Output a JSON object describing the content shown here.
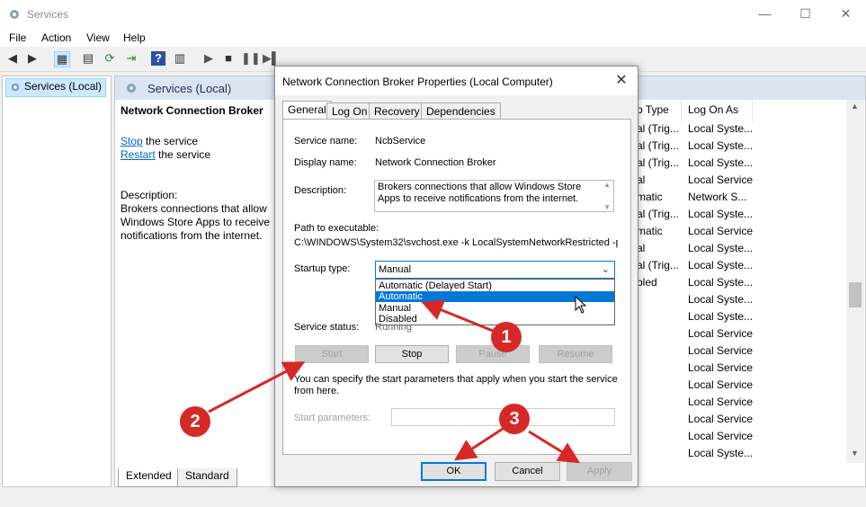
{
  "window": {
    "title": "Services",
    "minimize": "—",
    "maximize": "☐",
    "close": "✕"
  },
  "menu": [
    "File",
    "Action",
    "View",
    "Help"
  ],
  "tree": {
    "item": "Services (Local)"
  },
  "content": {
    "header": "Services (Local)",
    "service_name": "Network Connection Broker",
    "stop_link": "Stop",
    "stop_suffix": " the service",
    "restart_link": "Restart",
    "restart_suffix": " the service",
    "description_label": "Description:",
    "description_lines": [
      "Brokers connections that allow",
      "Windows Store Apps to receive",
      "notifications from the internet."
    ],
    "columns": {
      "startup": "p Type",
      "logon": "Log On As"
    },
    "rows": [
      {
        "s": "al (Trig...",
        "l": "Local Syste..."
      },
      {
        "s": "al (Trig...",
        "l": "Local Syste..."
      },
      {
        "s": "al (Trig...",
        "l": "Local Syste..."
      },
      {
        "s": "al",
        "l": "Local Service"
      },
      {
        "s": "matic",
        "l": "Network S..."
      },
      {
        "s": "al (Trig...",
        "l": "Local Syste..."
      },
      {
        "s": "matic",
        "l": "Local Service"
      },
      {
        "s": "al",
        "l": "Local Syste..."
      },
      {
        "s": "al (Trig...",
        "l": "Local Syste..."
      },
      {
        "s": "bled",
        "l": "Local Syste..."
      },
      {
        "s": "",
        "l": "Local Syste..."
      },
      {
        "s": "",
        "l": "Local Syste..."
      },
      {
        "s": "",
        "l": "Local Service"
      },
      {
        "s": "",
        "l": "Local Service"
      },
      {
        "s": "",
        "l": "Local Service"
      },
      {
        "s": "",
        "l": "Local Service"
      },
      {
        "s": "",
        "l": "Local Service"
      },
      {
        "s": "",
        "l": "Local Service"
      },
      {
        "s": "",
        "l": "Local Service"
      },
      {
        "s": "",
        "l": "Local Syste..."
      }
    ],
    "tabs": [
      "Extended",
      "Standard"
    ]
  },
  "dialog": {
    "title": "Network Connection Broker Properties (Local Computer)",
    "close": "✕",
    "tabs": [
      "General",
      "Log On",
      "Recovery",
      "Dependencies"
    ],
    "service_name_label": "Service name:",
    "service_name": "NcbService",
    "display_name_label": "Display name:",
    "display_name": "Network Connection Broker",
    "description_label": "Description:",
    "description": "Brokers connections that allow Windows Store Apps to receive notifications from the internet.",
    "path_label": "Path to executable:",
    "path": "C:\\WINDOWS\\System32\\svchost.exe -k LocalSystemNetworkRestricted -p",
    "startup_label": "Startup type:",
    "startup_value": "Manual",
    "startup_options": [
      "Automatic (Delayed Start)",
      "Automatic",
      "Manual",
      "Disabled"
    ],
    "startup_highlighted": "Automatic",
    "status_label": "Service status:",
    "status_value": "Running",
    "buttons": {
      "start": "Start",
      "stop": "Stop",
      "pause": "Pause",
      "resume": "Resume"
    },
    "hint": "You can specify the start parameters that apply when you start the service from here.",
    "params_label": "Start parameters:",
    "ok": "OK",
    "cancel": "Cancel",
    "apply": "Apply"
  },
  "annotations": [
    "1",
    "2",
    "3"
  ],
  "colors": {
    "annotation": "#d72828",
    "selection": "#0078d7",
    "link": "#0066cc"
  }
}
